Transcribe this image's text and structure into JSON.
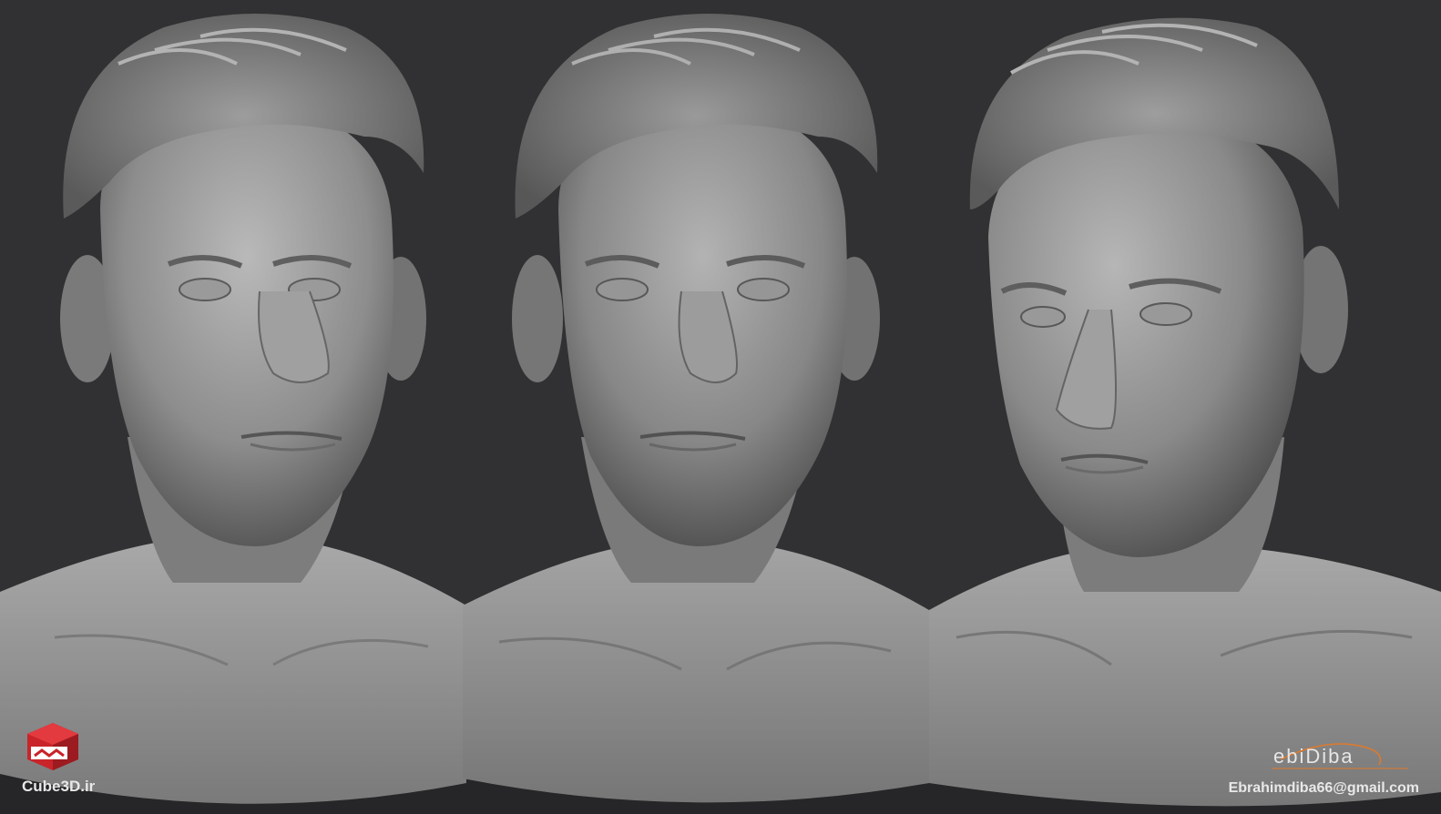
{
  "watermark_left": {
    "logo_icon": "red-cube-logo-icon",
    "site": "Cube3D.ir",
    "brand_color": "#c8242a"
  },
  "watermark_right": {
    "signature_logo": "ebiDiba",
    "email": "Ebrahimdiba66@gmail.com",
    "accent_color": "#e07a2a"
  },
  "colors": {
    "background": "#313133",
    "band": "#262628",
    "sculpt_light": "#c9c9c9",
    "sculpt_mid": "#8a8a8a",
    "sculpt_dark": "#4a4a4a"
  }
}
